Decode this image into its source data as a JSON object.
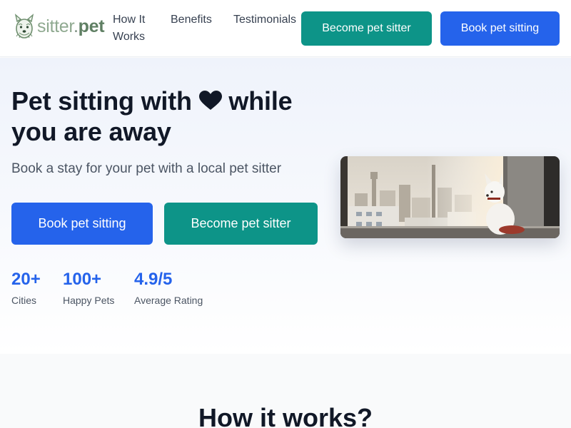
{
  "header": {
    "logo": {
      "part1": "sitter",
      "part2": ".",
      "part3": "pet"
    },
    "nav": [
      {
        "label": "How It Works"
      },
      {
        "label": "Benefits"
      },
      {
        "label": "Testimonials"
      }
    ],
    "become_label": "Become pet sitter",
    "book_label": "Book pet sitting"
  },
  "hero": {
    "title_part1": "Pet sitting with",
    "title_icon": "heart-icon",
    "title_part2": "while you are away",
    "subtitle": "Book a stay for your pet with a local pet sitter",
    "book_label": "Book pet sitting",
    "become_label": "Become pet sitter",
    "stats": [
      {
        "value": "20+",
        "label": "Cities"
      },
      {
        "value": "100+",
        "label": "Happy Pets"
      },
      {
        "value": "4.9/5",
        "label": "Average Rating"
      }
    ],
    "image_icon": "dog-at-window-photo"
  },
  "how": {
    "title": "How it works?"
  },
  "colors": {
    "teal": "#0d9488",
    "blue": "#2563eb",
    "stat_blue": "#2563eb",
    "logo_green": "#5f7f63"
  }
}
